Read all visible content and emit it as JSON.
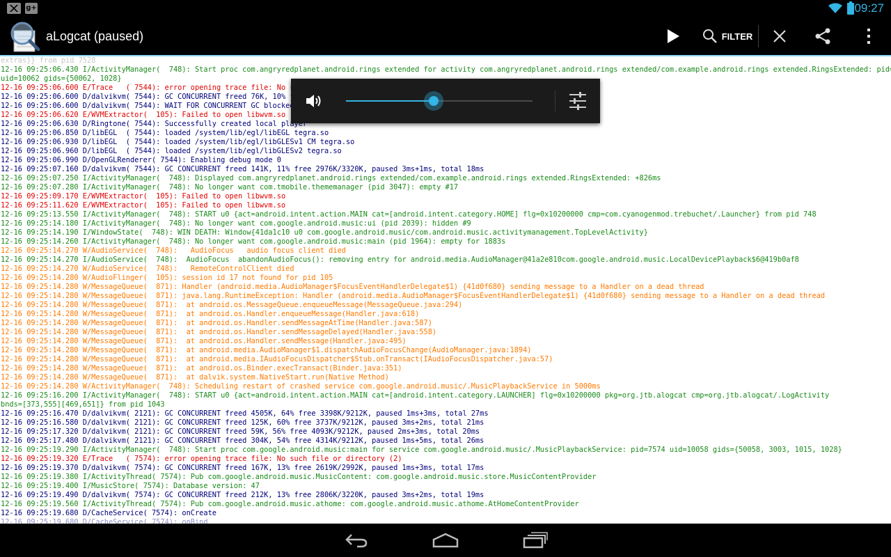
{
  "status_bar": {
    "time": "09:27",
    "icons": [
      "gmail-icon",
      "google-plus-icon",
      "wifi-icon",
      "battery-icon"
    ],
    "gplus_label": "g+"
  },
  "action_bar": {
    "title": "aLogcat (paused)",
    "filter_label": "FILTER",
    "icons": [
      "app-magnifier-icon",
      "play-icon",
      "search-icon",
      "close-icon",
      "share-icon",
      "overflow-menu-icon"
    ]
  },
  "log": {
    "lines": [
      {
        "level": "V",
        "text": "extras}} from pid 7528",
        "faded": true
      },
      {
        "level": "I",
        "text": "12-16 09:25:06.430 I/ActivityManager(  748): Start proc com.angryredplanet.android.rings extended for activity com.angryredplanet.android.rings extended/com.example.android.rings extended.RingsExtended: pid=7544"
      },
      {
        "level": "I",
        "text": "uid=10062 gids={50062, 1028}"
      },
      {
        "level": "E",
        "text": "12-16 09:25:06.600 E/Trace   ( 7544): error opening trace file: No such file or directory (2)"
      },
      {
        "level": "D",
        "text": "12-16 09:25:06.600 D/dalvikvm( 7544): GC CONCURRENT freed 76K, 10% free 2659K/2952K, paused 1ms+2ms, total 14ms"
      },
      {
        "level": "D",
        "text": "12-16 09:25:06.600 D/dalvikvm( 7544): WAIT FOR CONCURRENT GC blocked 1ms"
      },
      {
        "level": "E",
        "text": "12-16 09:25:06.620 E/WVMExtractor(  105): Failed to open libwvm.so"
      },
      {
        "level": "D",
        "text": "12-16 09:25:06.630 D/Ringtone( 7544): Successfully created local player"
      },
      {
        "level": "D",
        "text": "12-16 09:25:06.850 D/libEGL  ( 7544): loaded /system/lib/egl/libEGL tegra.so"
      },
      {
        "level": "D",
        "text": "12-16 09:25:06.930 D/libEGL  ( 7544): loaded /system/lib/egl/libGLESv1 CM tegra.so"
      },
      {
        "level": "D",
        "text": "12-16 09:25:06.960 D/libEGL  ( 7544): loaded /system/lib/egl/libGLESv2 tegra.so"
      },
      {
        "level": "D",
        "text": "12-16 09:25:06.990 D/OpenGLRenderer( 7544): Enabling debug mode 0"
      },
      {
        "level": "D",
        "text": "12-16 09:25:07.160 D/dalvikvm( 7544): GC CONCURRENT freed 141K, 11% free 2976K/3320K, paused 3ms+1ms, total 18ms"
      },
      {
        "level": "I",
        "text": "12-16 09:25:07.250 I/ActivityManager(  748): Displayed com.angryredplanet.android.rings extended/com.example.android.rings extended.RingsExtended: +826ms"
      },
      {
        "level": "I",
        "text": "12-16 09:25:07.280 I/ActivityManager(  748): No longer want com.tmobile.thememanager (pid 3047): empty #17"
      },
      {
        "level": "E",
        "text": "12-16 09:25:09.170 E/WVMExtractor(  105): Failed to open libwvm.so"
      },
      {
        "level": "E",
        "text": "12-16 09:25:11.620 E/WVMExtractor(  105): Failed to open libwvm.so"
      },
      {
        "level": "I",
        "text": "12-16 09:25:13.550 I/ActivityManager(  748): START u0 {act=android.intent.action.MAIN cat=[android.intent.category.HOME] flg=0x10200000 cmp=com.cyanogenmod.trebuchet/.Launcher} from pid 748"
      },
      {
        "level": "I",
        "text": "12-16 09:25:14.180 I/ActivityManager(  748): No longer want com.google.android.music:ui (pid 2039): hidden #9"
      },
      {
        "level": "I",
        "text": "12-16 09:25:14.190 I/WindowState(  748): WIN DEATH: Window{41da1c10 u0 com.google.android.music/com.android.music.activitymanagement.TopLevelActivity}"
      },
      {
        "level": "I",
        "text": "12-16 09:25:14.260 I/ActivityManager(  748): No longer want com.google.android.music:main (pid 1964): empty for 1883s"
      },
      {
        "level": "W",
        "text": "12-16 09:25:14.270 W/AudioService(  748):   AudioFocus   audio focus client died"
      },
      {
        "level": "I",
        "text": "12-16 09:25:14.270 I/AudioService(  748):  AudioFocus  abandonAudioFocus(): removing entry for android.media.AudioManager@41a2e810com.google.android.music.LocalDevicePlayback$6@419b0af8"
      },
      {
        "level": "W",
        "text": "12-16 09:25:14.270 W/AudioService(  748):   RemoteControlClient died"
      },
      {
        "level": "W",
        "text": "12-16 09:25:14.280 W/AudioFlinger(  105): session id 17 not found for pid 105"
      },
      {
        "level": "W",
        "text": "12-16 09:25:14.280 W/MessageQueue(  871): Handler (android.media.AudioManager$FocusEventHandlerDelegate$1) {41d0f680} sending message to a Handler on a dead thread"
      },
      {
        "level": "W",
        "text": "12-16 09:25:14.280 W/MessageQueue(  871): java.lang.RuntimeException: Handler (android.media.AudioManager$FocusEventHandlerDelegate$1) {41d0f680} sending message to a Handler on a dead thread"
      },
      {
        "level": "W",
        "text": "12-16 09:25:14.280 W/MessageQueue(  871):  at android.os.MessageQueue.enqueueMessage(MessageQueue.java:294)"
      },
      {
        "level": "W",
        "text": "12-16 09:25:14.280 W/MessageQueue(  871):  at android.os.Handler.enqueueMessage(Handler.java:618)"
      },
      {
        "level": "W",
        "text": "12-16 09:25:14.280 W/MessageQueue(  871):  at android.os.Handler.sendMessageAtTime(Handler.java:587)"
      },
      {
        "level": "W",
        "text": "12-16 09:25:14.280 W/MessageQueue(  871):  at android.os.Handler.sendMessageDelayed(Handler.java:558)"
      },
      {
        "level": "W",
        "text": "12-16 09:25:14.280 W/MessageQueue(  871):  at android.os.Handler.sendMessage(Handler.java:495)"
      },
      {
        "level": "W",
        "text": "12-16 09:25:14.280 W/MessageQueue(  871):  at android.media.AudioManager$1.dispatchAudioFocusChange(AudioManager.java:1894)"
      },
      {
        "level": "W",
        "text": "12-16 09:25:14.280 W/MessageQueue(  871):  at android.media.IAudioFocusDispatcher$Stub.onTransact(IAudioFocusDispatcher.java:57)"
      },
      {
        "level": "W",
        "text": "12-16 09:25:14.280 W/MessageQueue(  871):  at android.os.Binder.execTransact(Binder.java:351)"
      },
      {
        "level": "W",
        "text": "12-16 09:25:14.280 W/MessageQueue(  871):  at dalvik.system.NativeStart.run(Native Method)"
      },
      {
        "level": "W",
        "text": "12-16 09:25:14.280 W/ActivityManager(  748): Scheduling restart of crashed service com.google.android.music/.MusicPlaybackService in 5000ms"
      },
      {
        "level": "I",
        "text": "12-16 09:25:16.200 I/ActivityManager(  748): START u0 {act=android.intent.action.MAIN cat=[android.intent.category.LAUNCHER] flg=0x10200000 pkg=org.jtb.alogcat cmp=org.jtb.alogcat/.LogActivity"
      },
      {
        "level": "I",
        "text": "bnds=[373,555][469,651]} from pid 1043"
      },
      {
        "level": "D",
        "text": "12-16 09:25:16.470 D/dalvikvm( 2121): GC CONCURRENT freed 4505K, 64% free 3398K/9212K, paused 1ms+3ms, total 27ms"
      },
      {
        "level": "D",
        "text": "12-16 09:25:16.580 D/dalvikvm( 2121): GC CONCURRENT freed 125K, 60% free 3737K/9212K, paused 3ms+2ms, total 21ms"
      },
      {
        "level": "D",
        "text": "12-16 09:25:17.320 D/dalvikvm( 2121): GC CONCURRENT freed 59K, 56% free 4093K/9212K, paused 2ms+3ms, total 20ms"
      },
      {
        "level": "D",
        "text": "12-16 09:25:17.480 D/dalvikvm( 2121): GC CONCURRENT freed 304K, 54% free 4314K/9212K, paused 1ms+5ms, total 26ms"
      },
      {
        "level": "I",
        "text": "12-16 09:25:19.290 I/ActivityManager(  748): Start proc com.google.android.music:main for service com.google.android.music/.MusicPlaybackService: pid=7574 uid=10058 gids={50058, 3003, 1015, 1028}"
      },
      {
        "level": "E",
        "text": "12-16 09:25:19.320 E/Trace   ( 7574): error opening trace file: No such file or directory (2)"
      },
      {
        "level": "D",
        "text": "12-16 09:25:19.370 D/dalvikvm( 7574): GC CONCURRENT freed 167K, 13% free 2619K/2992K, paused 1ms+3ms, total 17ms"
      },
      {
        "level": "I",
        "text": "12-16 09:25:19.380 I/ActivityThread( 7574): Pub com.google.android.music.MusicContent: com.google.android.music.store.MusicContentProvider"
      },
      {
        "level": "I",
        "text": "12-16 09:25:19.400 I/MusicStore( 7574): Database version: 47"
      },
      {
        "level": "D",
        "text": "12-16 09:25:19.490 D/dalvikvm( 7574): GC CONCURRENT freed 212K, 13% free 2806K/3220K, paused 3ms+2ms, total 19ms"
      },
      {
        "level": "I",
        "text": "12-16 09:25:19.560 I/ActivityThread( 7574): Pub com.google.android.music.athome: com.google.android.music.athome.AtHomeContentProvider"
      },
      {
        "level": "D",
        "text": "12-16 09:25:19.680 D/CacheService( 7574): onCreate"
      },
      {
        "level": "D",
        "text": "12-16 09:25:19.680 D/CacheService( 7574): onBind",
        "faded": true
      }
    ]
  },
  "volume_panel": {
    "level_fraction": 0.47,
    "icons": [
      "speaker-icon",
      "equalizer-settings-icon"
    ]
  },
  "nav_bar": {
    "icons": [
      "back-icon",
      "home-icon",
      "recent-apps-icon"
    ]
  },
  "colors": {
    "accent": "#33b5e5",
    "info": "#1a8a1a",
    "error": "#e00000",
    "debug": "#00007a",
    "warning": "#ff7a00"
  }
}
